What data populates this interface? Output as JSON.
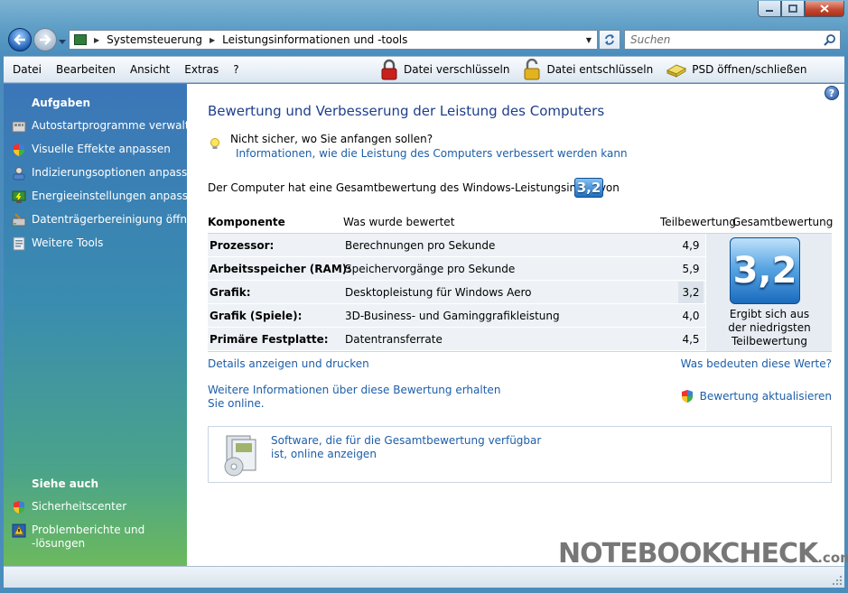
{
  "window": {
    "caption_buttons": [
      "minimize",
      "maximize",
      "close"
    ]
  },
  "address": {
    "crumbs": [
      "Systemsteuerung",
      "Leistungsinformationen und -tools"
    ],
    "search_placeholder": "Suchen"
  },
  "menu": {
    "items": [
      "Datei",
      "Bearbeiten",
      "Ansicht",
      "Extras",
      "?"
    ],
    "tools": [
      {
        "label": "Datei verschlüsseln",
        "icon": "lock-icon"
      },
      {
        "label": "Datei entschlüsseln",
        "icon": "unlock-icon"
      },
      {
        "label": "PSD öffnen/schließen",
        "icon": "drive-icon"
      }
    ]
  },
  "sidebar": {
    "tasks_heading": "Aufgaben",
    "tasks": [
      {
        "label": "Autostartprogramme verwalten",
        "icon": "startup-icon"
      },
      {
        "label": "Visuelle Effekte anpassen",
        "icon": "shield-icon"
      },
      {
        "label": "Indizierungsoptionen anpassen",
        "icon": "indexing-icon"
      },
      {
        "label": "Energieeinstellungen anpassen",
        "icon": "power-icon"
      },
      {
        "label": "Datenträgerbereinigung öffnen",
        "icon": "disk-cleanup-icon"
      },
      {
        "label": "Weitere Tools",
        "icon": "tools-icon"
      }
    ],
    "see_also_heading": "Siehe auch",
    "see_also": [
      {
        "label": "Sicherheitscenter",
        "icon": "security-center-icon"
      },
      {
        "label": "Problemberichte und -lösungen",
        "line1": "Problemberichte und",
        "line2": "-lösungen",
        "icon": "problem-reports-icon"
      }
    ]
  },
  "main": {
    "heading": "Bewertung und Verbesserung der Leistung des Computers",
    "unsure": "Nicht sicher, wo Sie anfangen sollen?",
    "info_link": "Informationen, wie die Leistung des Computers verbessert werden kann",
    "overall_text": "Der Computer hat eine Gesamtbewertung des Windows-Leistungsindex von",
    "overall_score": "3,2",
    "table": {
      "headers": {
        "component": "Komponente",
        "what": "Was wurde bewertet",
        "subscore": "Teilbewertung",
        "total": "Gesamtbewertung"
      },
      "rows": [
        {
          "component": "Prozessor:",
          "what": "Berechnungen pro Sekunde",
          "score": "4,9"
        },
        {
          "component": "Arbeitsspeicher (RAM):",
          "what": "Speichervorgänge pro Sekunde",
          "score": "5,9"
        },
        {
          "component": "Grafik:",
          "what": "Desktopleistung für Windows Aero",
          "score": "3,2"
        },
        {
          "component": "Grafik (Spiele):",
          "what": "3D-Business- und Gaminggrafikleistung",
          "score": "4,0"
        },
        {
          "component": "Primäre Festplatte:",
          "what": "Datentransferrate",
          "score": "4,5"
        }
      ],
      "total_score": "3,2",
      "total_caption_lines": [
        "Ergibt sich aus",
        "der niedrigsten",
        "Teilbewertung"
      ]
    },
    "details_link": "Details anzeigen und drucken",
    "meaning_link": "Was bedeuten diese Werte?",
    "more_info_line1": "Weitere Informationen über diese Bewertung erhalten",
    "more_info_line2": "Sie online.",
    "update_link": "Bewertung aktualisieren",
    "software_line1": "Software, die für die Gesamtbewertung verfügbar",
    "software_line2": "ist, online anzeigen"
  },
  "watermark": {
    "text": "NOTEBOOKCHECK",
    "suffix": ".com"
  }
}
